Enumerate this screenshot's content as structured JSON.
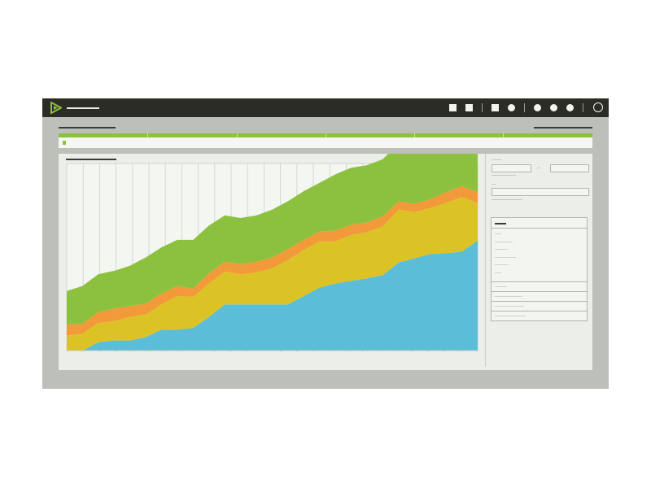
{
  "app": {
    "title": "",
    "brand_color": "#8cc13f",
    "toolbar_icons": [
      "square-icon",
      "square-icon",
      "square-icon",
      "circle-icon",
      "circle-icon",
      "circle-icon",
      "circle-icon",
      "user-icon"
    ]
  },
  "colors": {
    "topbar": "#2b2c26",
    "frame": "#bdbfb9",
    "panel": "#ecefe9",
    "series": [
      "#5bbdd8",
      "#dcc325",
      "#f2993a",
      "#8cc13f"
    ]
  },
  "filter": {
    "label": ""
  },
  "chart_data": {
    "type": "area",
    "stacked": true,
    "title": "",
    "xlabel": "",
    "ylabel": "",
    "x": [
      1,
      2,
      3,
      4,
      5,
      6,
      7,
      8,
      9,
      10,
      11,
      12,
      13,
      14,
      15,
      16,
      17,
      18,
      19,
      20,
      21,
      22,
      23,
      24,
      25,
      26,
      27
    ],
    "ylim": [
      0,
      223
    ],
    "grid": true,
    "series": [
      {
        "color": "#5bbdd8",
        "values": [
          0,
          0,
          10,
          12,
          12,
          16,
          25,
          25,
          27,
          40,
          55,
          55,
          55,
          55,
          55,
          65,
          75,
          80,
          83,
          86,
          90,
          105,
          110,
          115,
          116,
          118,
          131
        ]
      },
      {
        "color": "#dcc325",
        "values": [
          18,
          20,
          23,
          23,
          28,
          27,
          30,
          40,
          37,
          40,
          39,
          36,
          38,
          43,
          53,
          55,
          55,
          50,
          55,
          55,
          58,
          63,
          55,
          55,
          60,
          65,
          45
        ]
      },
      {
        "color": "#f2993a",
        "values": [
          13,
          12,
          13,
          15,
          13,
          13,
          13,
          12,
          10,
          12,
          12,
          12,
          13,
          13,
          13,
          12,
          12,
          13,
          12,
          12,
          12,
          10,
          10,
          10,
          13,
          13,
          13
        ]
      },
      {
        "color": "#8cc13f",
        "values": [
          40,
          45,
          45,
          45,
          48,
          55,
          55,
          55,
          58,
          57,
          55,
          55,
          55,
          57,
          57,
          58,
          58,
          67,
          68,
          68,
          68,
          70,
          72,
          73,
          74,
          75,
          71
        ]
      }
    ]
  }
}
